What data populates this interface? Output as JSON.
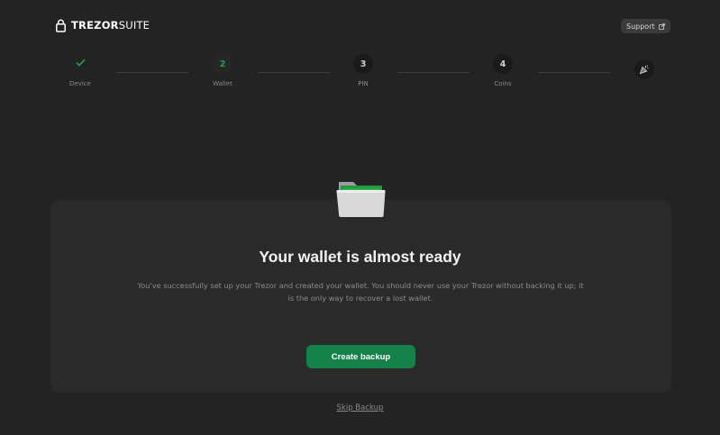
{
  "header": {
    "brand_bold": "TREZOR",
    "brand_light": "SUITE",
    "support_label": "Support"
  },
  "stepper": {
    "steps": [
      {
        "number": "",
        "label": "Device",
        "state": "done"
      },
      {
        "number": "2",
        "label": "Wallet",
        "state": "active"
      },
      {
        "number": "3",
        "label": "PIN",
        "state": "pending"
      },
      {
        "number": "4",
        "label": "Coins",
        "state": "pending"
      }
    ]
  },
  "main": {
    "title": "Your wallet is almost ready",
    "description": "You've successfully set up your Trezor and created your wallet. You should never use your Trezor without backing it up; it is the only way to recover a lost wallet.",
    "primary_button": "Create backup",
    "skip_link": "Skip Backup"
  },
  "colors": {
    "background": "#232323",
    "card": "#2a2a2a",
    "accent": "#14804a",
    "active_step": "#28a050"
  },
  "icons": {
    "logo": "lock-icon",
    "support": "external-link-icon",
    "device_step": "check-icon",
    "finish": "party-popper-icon",
    "illustration": "folder-icon"
  }
}
